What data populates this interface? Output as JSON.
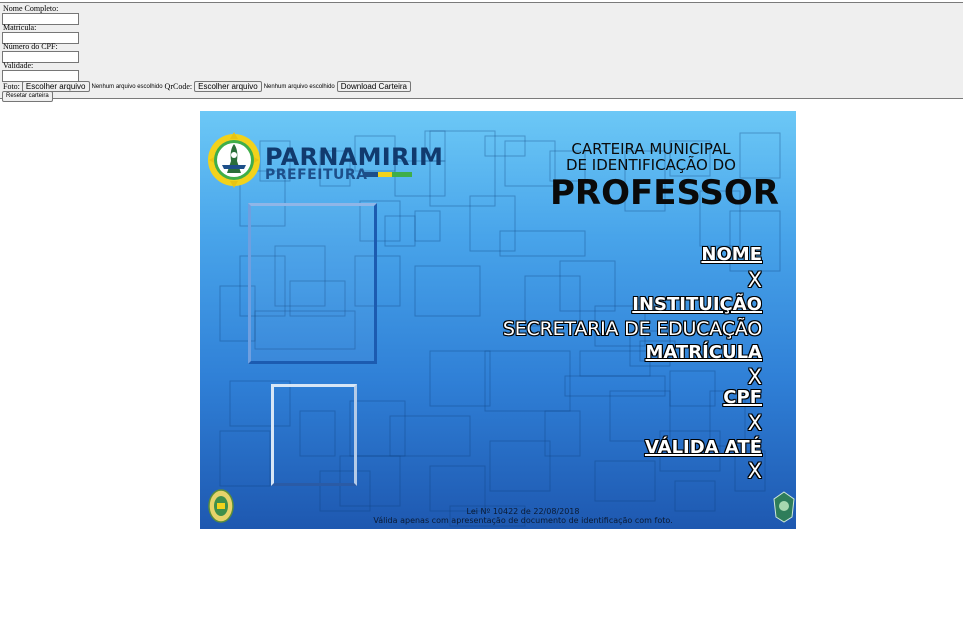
{
  "form": {
    "name_label": "Nome Completo:",
    "name_value": "",
    "matricula_label": "Matrícula:",
    "matricula_value": "",
    "cpf_label": "Número do CPF:",
    "cpf_value": "",
    "validade_label": "Validade:",
    "validade_value": "",
    "foto_label": "Foto:",
    "choose_file_label": "Escolher arquivo",
    "no_file_text": "Nenhum arquivo escolhido",
    "qrcode_label": "QrCode:",
    "download_label": "Download Carteira",
    "reset_label": "Resetar carteira"
  },
  "card": {
    "brand_name": "PARNAMIRIM",
    "brand_sub": "PREFEITURA",
    "title_line1": "CARTEIRA MUNICIPAL",
    "title_line2": "DE IDENTIFICAÇÃO DO",
    "title_line3": "PROFESSOR",
    "fields": {
      "nome_label": "NOME",
      "nome_value": "X",
      "instituicao_label": "INSTITUIÇÃO",
      "instituicao_value": "SECRETARIA DE EDUCAÇÃO",
      "matricula_label": "MATRÍCULA",
      "matricula_value": "X",
      "cpf_label": "CPF",
      "cpf_value": "X",
      "validade_label": "VÁLIDA ATÉ",
      "validade_value": "X"
    },
    "footer_law": "Lei Nº 10422 de 22/08/2018",
    "footer_note": "Válida apenas com apresentação de documento de identificação com foto."
  },
  "colors": {
    "card_top": "#6cc8f6",
    "card_bottom": "#1e58b0",
    "brand_navy": "#113a6e",
    "stripe_blue": "#1d4f8a",
    "stripe_yellow": "#f2d21b",
    "stripe_green": "#3fae49"
  },
  "icons": [
    "parnamirim-emblem-icon",
    "left-seal-icon",
    "right-seal-icon"
  ]
}
